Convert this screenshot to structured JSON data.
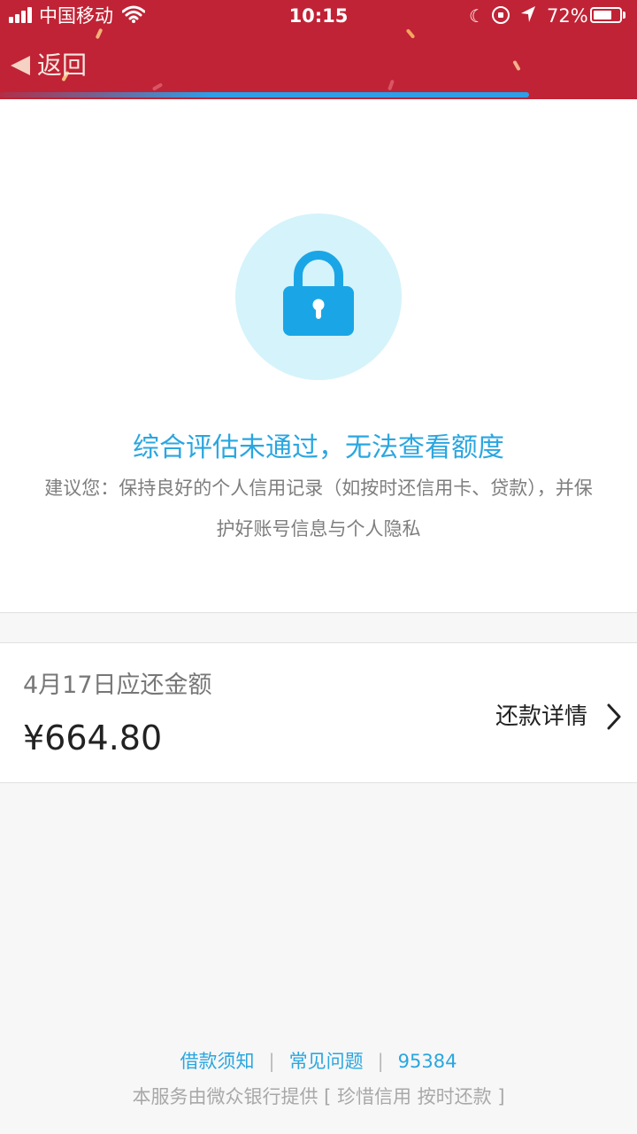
{
  "status_bar": {
    "carrier": "中国移动",
    "time": "10:15",
    "battery_percent": "72%",
    "battery_level": 0.72
  },
  "nav": {
    "back_label": "返回"
  },
  "progress": {
    "value": 0.83
  },
  "result": {
    "title": "综合评估未通过，无法查看额度",
    "description": "建议您：保持良好的个人信用记录（如按时还信用卡、贷款），并保护好账号信息与个人隐私"
  },
  "repayment": {
    "label": "4月17日应还金额",
    "amount": "¥664.80",
    "detail_label": "还款详情"
  },
  "footer": {
    "links": [
      "借款须知",
      "常见问题",
      "95384"
    ],
    "note": "本服务由微众银行提供 [ 珍惜信用 按时还款 ]"
  },
  "colors": {
    "header_bg": "#c02335",
    "accent_blue": "#2aa6e0",
    "lock_circle_bg": "#d5f3fb",
    "lock_blue": "#1aa6e6"
  },
  "icons": [
    "signal-icon",
    "wifi-icon",
    "moon-icon",
    "rotation-lock-icon",
    "location-arrow-icon",
    "battery-icon",
    "back-arrow-icon",
    "lock-icon",
    "chevron-right-icon"
  ]
}
